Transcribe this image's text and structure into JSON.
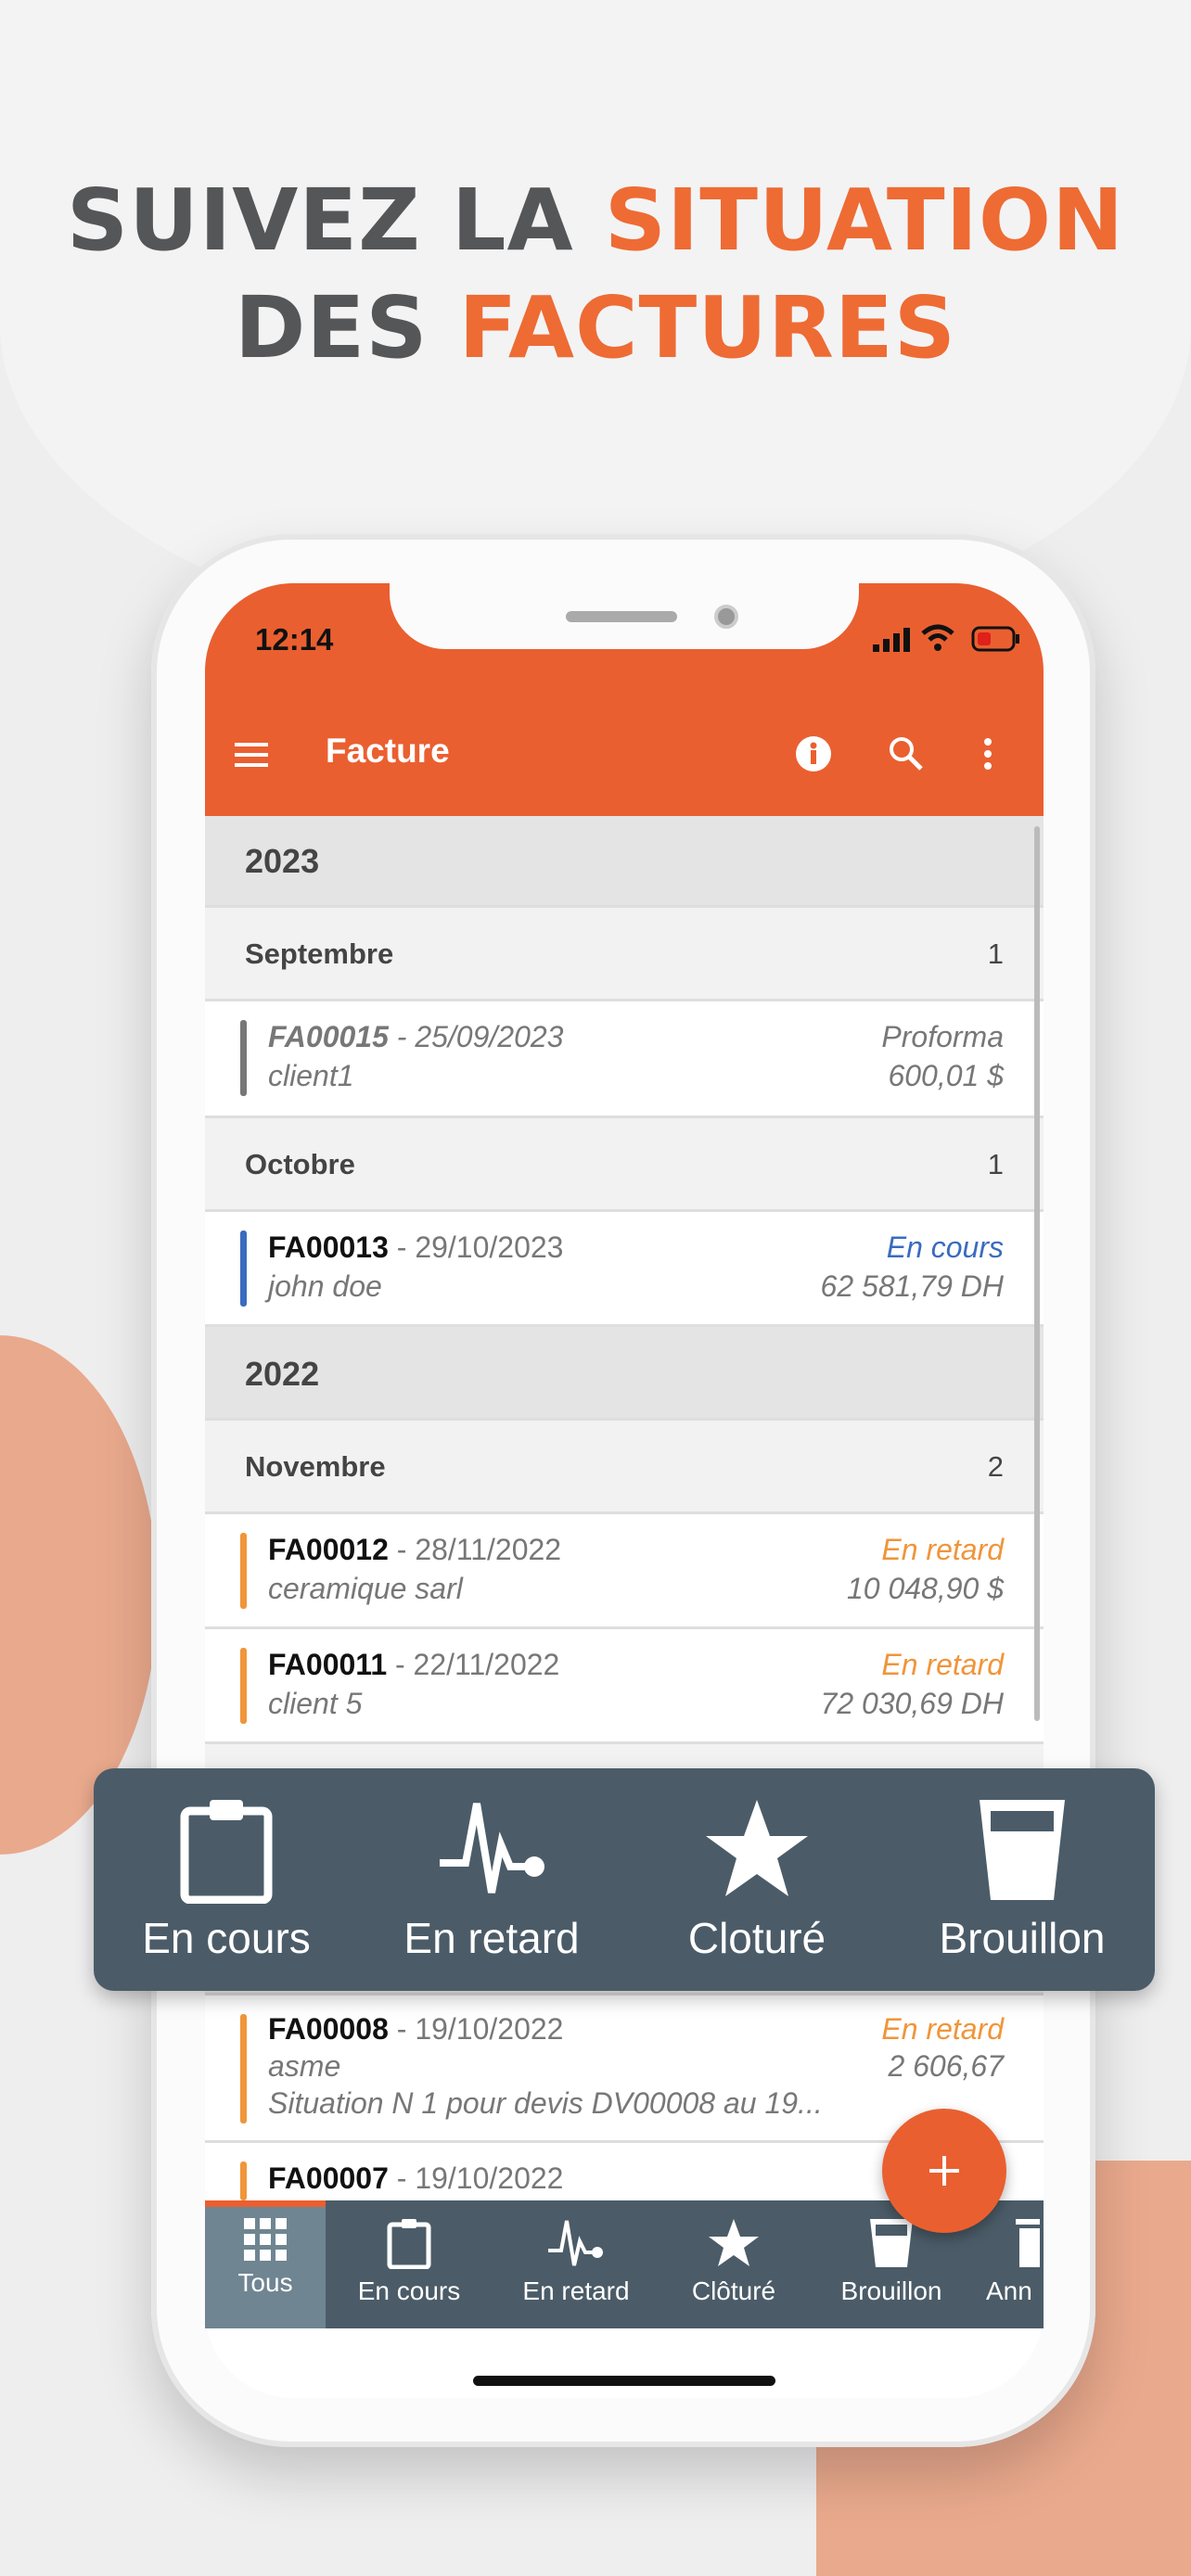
{
  "headline": {
    "line1_plain": "SUIVEZ LA ",
    "line1_accent": "SITUATION",
    "line2_plain": "DES ",
    "line2_accent": "FACTURES"
  },
  "colors": {
    "accent": "#ea5f30",
    "nav": "#4b5c68",
    "en_cours": "#3b6bbf",
    "en_retard": "#f0953a",
    "proforma": "#777777"
  },
  "status_bar": {
    "time": "12:14",
    "icons": [
      "signal-icon",
      "wifi-icon",
      "battery-icon"
    ]
  },
  "appbar": {
    "title": "Facture",
    "icons": [
      "menu-icon",
      "info-icon",
      "search-icon",
      "more-vert-icon"
    ]
  },
  "list": {
    "y2023": "2023",
    "sept": {
      "label": "Septembre",
      "count": "1"
    },
    "fa15": {
      "num": "FA00015",
      "date": " - 25/09/2023",
      "client": "client1",
      "status": "Proforma",
      "amount": "600,01 $"
    },
    "oct": {
      "label": "Octobre",
      "count": "1"
    },
    "fa13": {
      "num": "FA00013",
      "date": " - 29/10/2023",
      "client": "john doe",
      "status": "En cours",
      "amount": "62 581,79 DH"
    },
    "y2022": "2022",
    "nov": {
      "label": "Novembre",
      "count": "2"
    },
    "fa12": {
      "num": "FA00012",
      "date": " - 28/11/2022",
      "client": "ceramique sarl",
      "status": "En retard",
      "amount": "10 048,90 $"
    },
    "fa11": {
      "num": "FA00011",
      "date": " - 22/11/2022",
      "client": "client 5",
      "status": "En retard",
      "amount": "72 030,69 DH"
    },
    "fa08": {
      "num": "FA00008",
      "date": " - 19/10/2022",
      "client": "asme",
      "note": "Situation N 1 pour devis DV00008 au 19...",
      "status": "En retard",
      "amount": "2 606,67"
    },
    "fa07": {
      "num": "FA00007",
      "date": " - 19/10/2022"
    }
  },
  "banner": {
    "items": [
      "En cours",
      "En retard",
      "Cloturé",
      "Brouillon"
    ]
  },
  "bottom_nav": {
    "active": "Tous",
    "items": [
      "Tous",
      "En cours",
      "En retard",
      "Clôturé",
      "Brouillon",
      "Ann"
    ]
  },
  "fab": {
    "label": "+"
  }
}
